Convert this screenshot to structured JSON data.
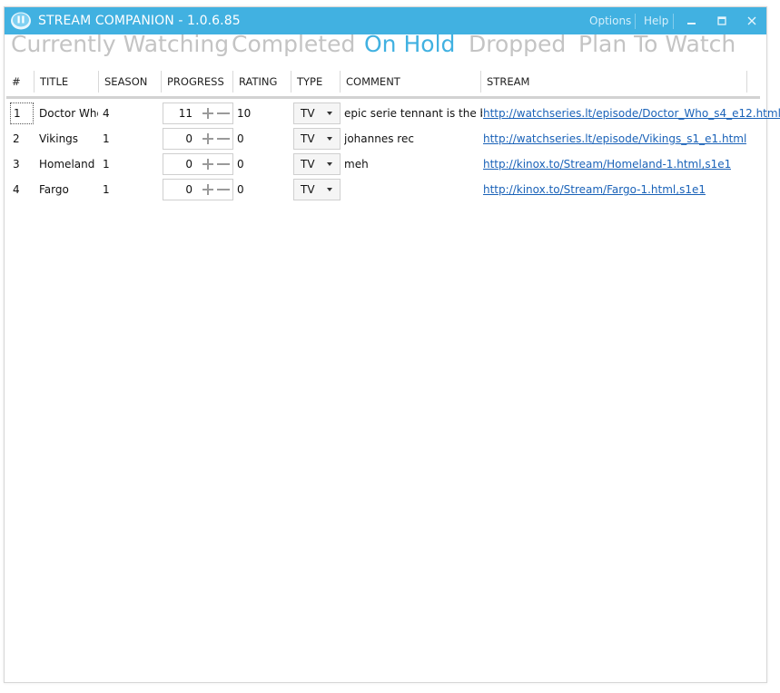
{
  "window": {
    "title": "STREAM COMPANION - 1.0.6.85",
    "icon": "pause-bubble-icon",
    "menu": {
      "options": "Options",
      "help": "Help"
    },
    "controls": [
      "minimize-icon",
      "maximize-icon",
      "close-icon"
    ]
  },
  "tabs": [
    {
      "label": "Currently Watching",
      "active": false
    },
    {
      "label": "Completed",
      "active": false
    },
    {
      "label": "On Hold",
      "active": true
    },
    {
      "label": "Dropped",
      "active": false
    },
    {
      "label": "Plan To Watch",
      "active": false
    }
  ],
  "table": {
    "columns": [
      "#",
      "TITLE",
      "SEASON",
      "PROGRESS",
      "RATING",
      "TYPE",
      "COMMENT",
      "STREAM"
    ],
    "rows": [
      {
        "num": "1",
        "title": "Doctor Who",
        "season": "4",
        "progress": "11",
        "rating": "10",
        "type": "TV",
        "comment": "epic serie tennant is the best",
        "stream": "http://watchseries.lt/episode/Doctor_Who_s4_e12.html"
      },
      {
        "num": "2",
        "title": "Vikings",
        "season": "1",
        "progress": "0",
        "rating": "0",
        "type": "TV",
        "comment": "johannes rec",
        "stream": "http://watchseries.lt/episode/Vikings_s1_e1.html"
      },
      {
        "num": "3",
        "title": "Homeland",
        "season": "1",
        "progress": "0",
        "rating": "0",
        "type": "TV",
        "comment": "meh",
        "stream": "http://kinox.to/Stream/Homeland-1.html,s1e1"
      },
      {
        "num": "4",
        "title": "Fargo",
        "season": "1",
        "progress": "0",
        "rating": "0",
        "type": "TV",
        "comment": "",
        "stream": "http://kinox.to/Stream/Fargo-1.html,s1e1"
      }
    ]
  },
  "colors": {
    "accent": "#41b1e1",
    "inactive_tab": "#c4c4c4",
    "link": "#1a62b8"
  }
}
